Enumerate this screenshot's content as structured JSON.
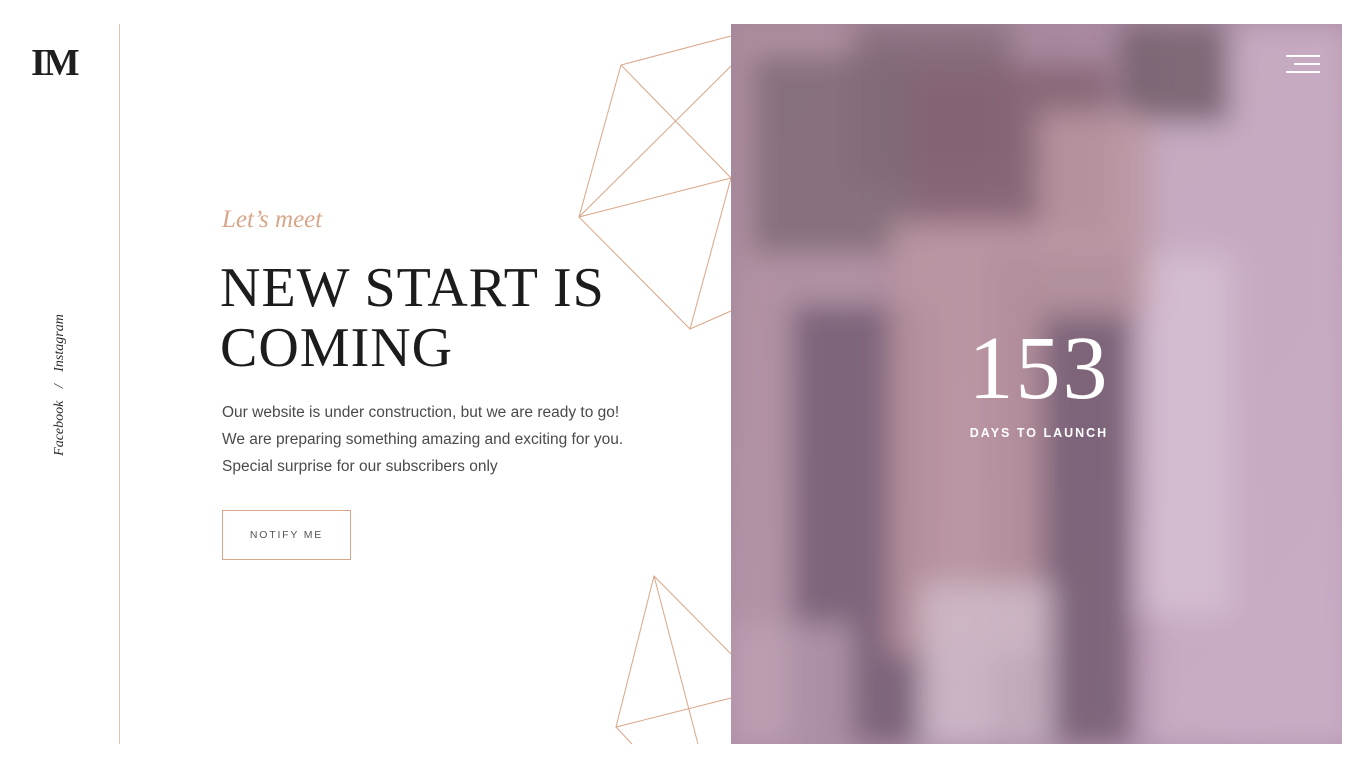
{
  "brand": {
    "logo_text": "IM"
  },
  "social": {
    "facebook": "Facebook",
    "separator": "/",
    "instagram": "Instagram"
  },
  "hero": {
    "eyebrow": "Let’s meet",
    "headline": "NEW START IS COMING",
    "description": "Our website is under construction, but we are ready to go! We are preparing something amazing and exciting for you. Special surprise for our subscribers only",
    "cta_label": "NOTIFY ME"
  },
  "countdown": {
    "value": "153",
    "label": "DAYS TO LAUNCH"
  },
  "menu": {
    "icon": "hamburger-menu-icon"
  },
  "colors": {
    "accent": "#d8a78a",
    "text_dark": "#1c1c1c",
    "overlay": "#b48fae"
  }
}
